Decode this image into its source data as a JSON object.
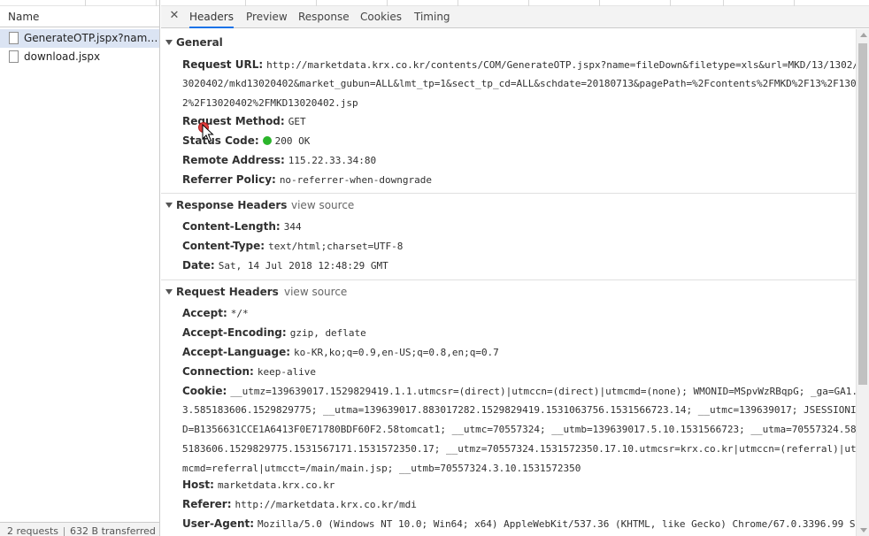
{
  "request_list": {
    "column_header": "Name",
    "requests": [
      {
        "name": "GenerateOTP.jspx?name=fileDown&filetype=xls"
      },
      {
        "name": "download.jspx"
      }
    ],
    "status": {
      "requests": "2 requests",
      "transferred": "632 B transferred"
    }
  },
  "tabs": {
    "close_icon": "close-icon",
    "items": [
      "Headers",
      "Preview",
      "Response",
      "Cookies",
      "Timing"
    ],
    "active": "Headers"
  },
  "general": {
    "title": "General",
    "request_url_key": "Request URL:",
    "request_url_lines": [
      "http://marketdata.krx.co.kr/contents/COM/GenerateOTP.jspx?name=fileDown&filetype=xls&url=MKD/13/1302/1",
      "3020402/mkd13020402&market_gubun=ALL&lmt_tp=1&sect_tp_cd=ALL&schdate=20180713&pagePath=%2Fcontents%2FMKD%2F13%2F130",
      "2%2F13020402%2FMKD13020402.jsp"
    ],
    "request_method_key": "Request Method:",
    "request_method": "GET",
    "status_code_key": "Status Code:",
    "status_code": "200 OK",
    "status_color": "#2bb52b",
    "remote_address_key": "Remote Address:",
    "remote_address": "115.22.33.34:80",
    "referrer_policy_key": "Referrer Policy:",
    "referrer_policy": "no-referrer-when-downgrade"
  },
  "response_headers": {
    "title": "Response Headers",
    "view_source": "view source",
    "rows": [
      {
        "key": "Content-Length:",
        "value": "344"
      },
      {
        "key": "Content-Type:",
        "value": "text/html;charset=UTF-8"
      },
      {
        "key": "Date:",
        "value": "Sat, 14 Jul 2018 12:48:29 GMT"
      }
    ]
  },
  "request_headers": {
    "title": "Request Headers",
    "view_source": "view source",
    "accept_key": "Accept:",
    "accept": "*/*",
    "accept_encoding_key": "Accept-Encoding:",
    "accept_encoding": "gzip, deflate",
    "accept_language_key": "Accept-Language:",
    "accept_language": "ko-KR,ko;q=0.9,en-US;q=0.8,en;q=0.7",
    "connection_key": "Connection:",
    "connection": "keep-alive",
    "cookie_key": "Cookie:",
    "cookie_lines": [
      "__utmz=139639017.1529829419.1.1.utmcsr=(direct)|utmccn=(direct)|utmcmd=(none); WMONID=MSpvWzRBqpG; _ga=GA1.",
      "3.585183606.1529829775; __utma=139639017.883017282.1529829419.1531063756.1531566723.14; __utmc=139639017; JSESSIONI",
      "D=B1356631CCE1A6413F0E71780BDF60F2.58tomcat1; __utmc=70557324; __utmb=139639017.5.10.1531566723; __utma=70557324.58",
      "5183606.1529829775.1531567171.1531572350.17; __utmz=70557324.1531572350.17.10.utmcsr=krx.co.kr|utmccn=(referral)|ut",
      "mcmd=referral|utmcct=/main/main.jsp; __utmb=70557324.3.10.1531572350"
    ],
    "host_key": "Host:",
    "host": "marketdata.krx.co.kr",
    "referer_key": "Referer:",
    "referer": "http://marketdata.krx.co.kr/mdi",
    "user_agent_key": "User-Agent:",
    "user_agent": "Mozilla/5.0 (Windows NT 10.0; Win64; x64) AppleWebKit/537.36 (KHTML, like Gecko) Chrome/67.0.3396.99 Saf"
  }
}
